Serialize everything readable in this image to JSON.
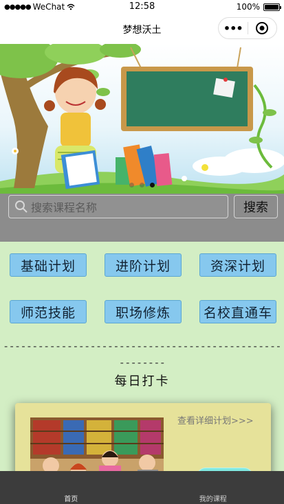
{
  "status_bar": {
    "carrier": "WeChat",
    "time": "12:58",
    "battery": "100%",
    "battery_level": 1.0
  },
  "nav": {
    "title": "梦想沃土"
  },
  "banner": {
    "slides": 3,
    "active_index": 2
  },
  "search": {
    "placeholder": "搜索课程名称",
    "button_label": "搜索"
  },
  "plans": [
    {
      "label": "基础计划"
    },
    {
      "label": "进阶计划"
    },
    {
      "label": "资深计划"
    },
    {
      "label": "师范技能"
    },
    {
      "label": "职场修炼"
    },
    {
      "label": "名校直通车"
    }
  ],
  "divider_text": "--------------------------------------------------------",
  "checkin": {
    "title": "每日打卡",
    "detail_link": "查看详细计划>>>"
  },
  "tabs": [
    {
      "label": "首页"
    },
    {
      "label": "我的课程"
    }
  ],
  "colors": {
    "page_bg": "#d3eec4",
    "search_bg": "#8c8c8c",
    "plan_button": "#86c8ee",
    "card_bg": "#e6e29a",
    "tab_bar": "#3c3c3c"
  }
}
